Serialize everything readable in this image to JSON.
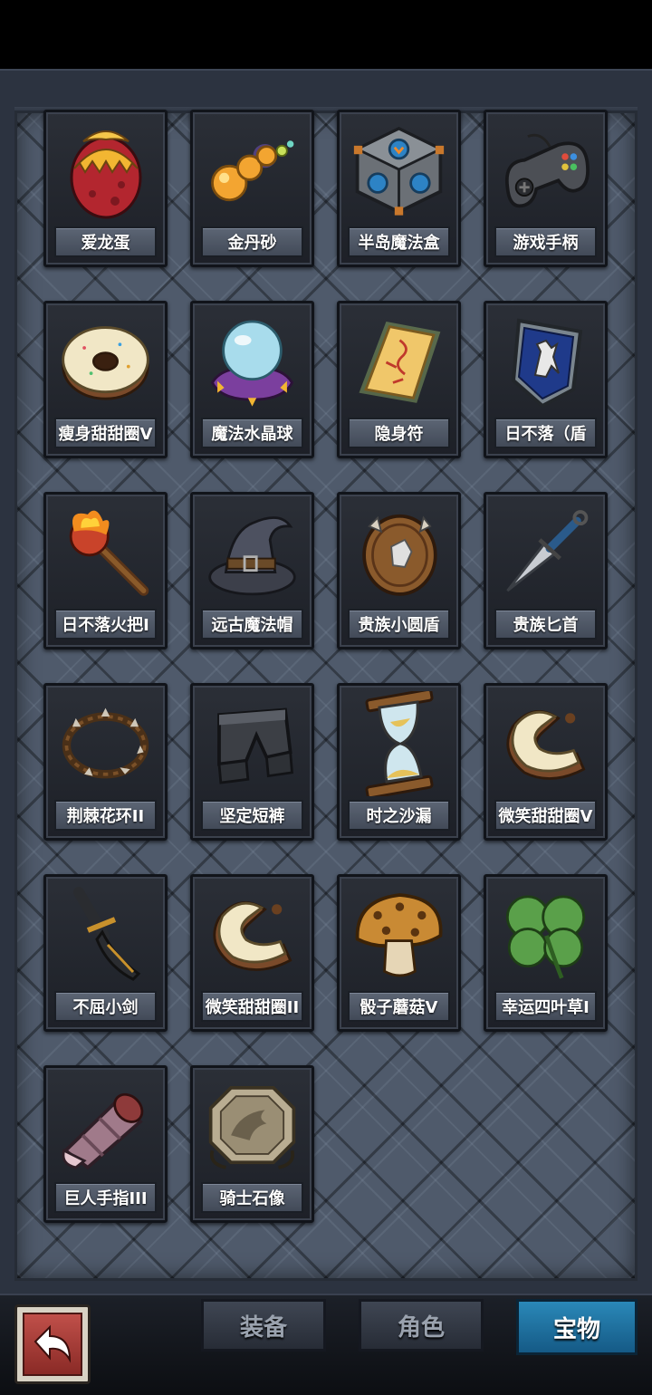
{
  "items": [
    {
      "name": "爱龙蛋",
      "icon": "dragon-egg-icon"
    },
    {
      "name": "金丹砂",
      "icon": "golden-pills-icon"
    },
    {
      "name": "半岛魔法盒",
      "icon": "magic-cube-icon"
    },
    {
      "name": "游戏手柄",
      "icon": "gamepad-icon"
    },
    {
      "name": "瘦身甜甜圈V",
      "icon": "donut-icon"
    },
    {
      "name": "魔法水晶球",
      "icon": "crystal-ball-icon"
    },
    {
      "name": "隐身符",
      "icon": "talisman-icon"
    },
    {
      "name": "日不落（盾",
      "icon": "lion-shield-icon"
    },
    {
      "name": "日不落火把I",
      "icon": "torch-icon"
    },
    {
      "name": "远古魔法帽",
      "icon": "wizard-hat-icon"
    },
    {
      "name": "贵族小圆盾",
      "icon": "round-shield-icon"
    },
    {
      "name": "贵族匕首",
      "icon": "dagger-icon"
    },
    {
      "name": "荆棘花环II",
      "icon": "thorn-wreath-icon"
    },
    {
      "name": "坚定短裤",
      "icon": "armored-shorts-icon"
    },
    {
      "name": "时之沙漏",
      "icon": "hourglass-icon"
    },
    {
      "name": "微笑甜甜圈V",
      "icon": "bitten-donut-icon"
    },
    {
      "name": "不屈小剑",
      "icon": "short-sword-icon"
    },
    {
      "name": "微笑甜甜圈II",
      "icon": "bitten-donut-icon"
    },
    {
      "name": "骰子蘑菇V",
      "icon": "dice-mushroom-icon"
    },
    {
      "name": "幸运四叶草I",
      "icon": "four-leaf-clover-icon"
    },
    {
      "name": "巨人手指III",
      "icon": "giant-finger-icon"
    },
    {
      "name": "骑士石像",
      "icon": "knight-statue-icon"
    }
  ],
  "tabs": [
    {
      "label": "装备",
      "active": false
    },
    {
      "label": "角色",
      "active": false
    },
    {
      "label": "宝物",
      "active": true
    }
  ],
  "back_icon": "return-arrow-icon",
  "colors": {
    "panel": "#4f5a6b",
    "card": "#2b2f37",
    "active_tab": "#2a88b8"
  }
}
